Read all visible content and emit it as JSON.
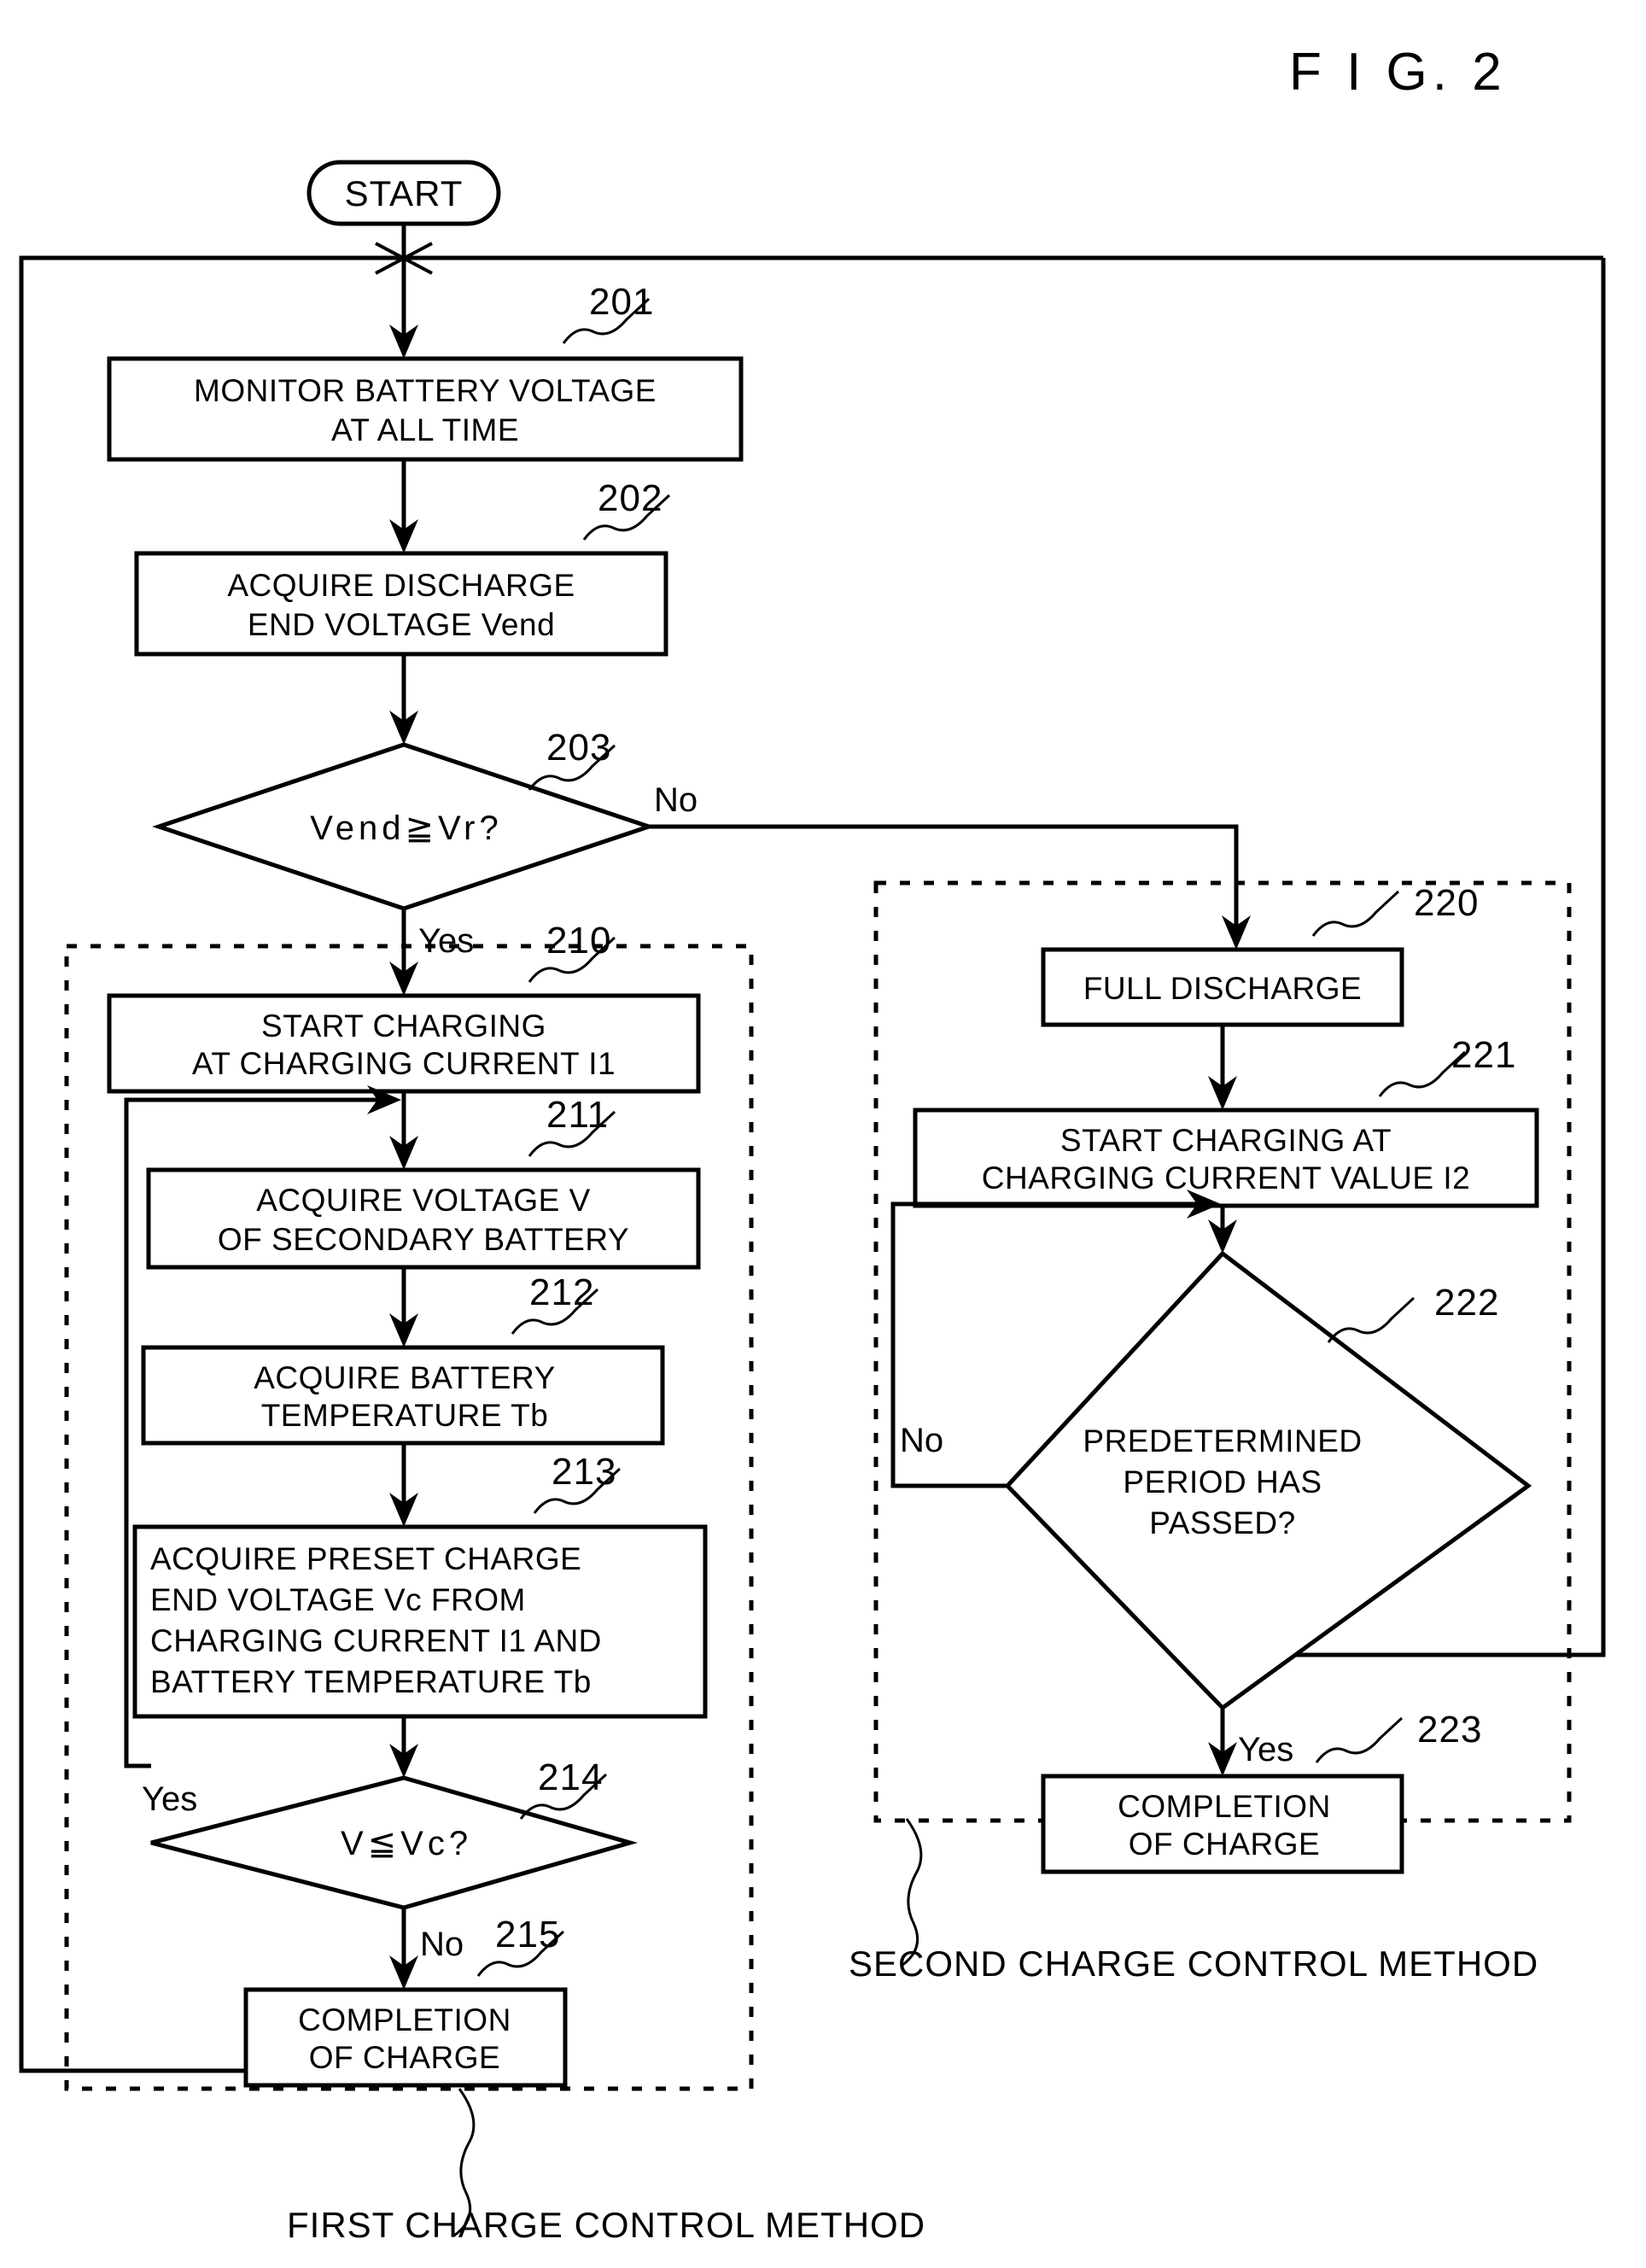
{
  "figure": {
    "label": "F I G.  2"
  },
  "nodes": {
    "start": {
      "id": "start",
      "label": "START"
    },
    "n201": {
      "ref": "201",
      "lines": [
        "MONITOR BATTERY VOLTAGE",
        "AT ALL TIME"
      ]
    },
    "n202": {
      "ref": "202",
      "lines": [
        "ACQUIRE DISCHARGE",
        "END VOLTAGE Vend"
      ]
    },
    "n203": {
      "ref": "203",
      "lines": [
        "Vend≧Vr?"
      ],
      "yes_label": "Yes",
      "no_label": "No"
    },
    "n210": {
      "ref": "210",
      "lines": [
        "START CHARGING",
        "AT CHARGING CURRENT I1"
      ]
    },
    "n211": {
      "ref": "211",
      "lines": [
        "ACQUIRE VOLTAGE V",
        "OF SECONDARY BATTERY"
      ]
    },
    "n212": {
      "ref": "212",
      "lines": [
        "ACQUIRE BATTERY",
        "TEMPERATURE Tb"
      ]
    },
    "n213": {
      "ref": "213",
      "lines": [
        "ACQUIRE PRESET CHARGE",
        "END VOLTAGE Vc FROM",
        "CHARGING CURRENT I1 AND",
        "BATTERY TEMPERATURE Tb"
      ]
    },
    "n214": {
      "ref": "214",
      "lines": [
        "V≦Vc?"
      ],
      "yes_label": "Yes",
      "no_label": "No"
    },
    "n215": {
      "ref": "215",
      "lines": [
        "COMPLETION",
        "OF CHARGE"
      ]
    },
    "n220": {
      "ref": "220",
      "lines": [
        "FULL DISCHARGE"
      ]
    },
    "n221": {
      "ref": "221",
      "lines": [
        "START CHARGING AT",
        "CHARGING CURRENT VALUE I2"
      ]
    },
    "n222": {
      "ref": "222",
      "lines": [
        "PREDETERMINED",
        "PERIOD HAS",
        "PASSED?"
      ],
      "yes_label": "Yes",
      "no_label": "No"
    },
    "n223": {
      "ref": "223",
      "lines": [
        "COMPLETION",
        "OF CHARGE"
      ]
    }
  },
  "captions": {
    "first_method": "FIRST CHARGE CONTROL METHOD",
    "second_method": "SECOND CHARGE CONTROL METHOD"
  },
  "colors": {
    "ink": "#000000",
    "paper": "#ffffff"
  }
}
